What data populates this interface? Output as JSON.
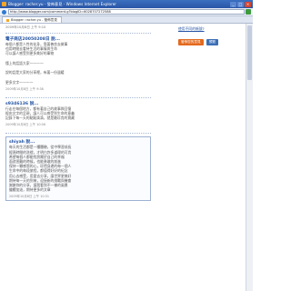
{
  "window": {
    "title": "Blogger: racher.yu - 發佈意見 - Windows Internet Explorer",
    "url": "http://www.blogger.com/comment.g?blogID=6028707272588"
  },
  "tab": {
    "label": "Blogger: racher.yu - 發佈意見"
  },
  "top_date": "2009年10月8日 上午 9:10",
  "sidebar": {
    "link": "使用不同的帳號?",
    "buttons": [
      "發佈您的意見",
      "預覽"
    ]
  },
  "comments": [
    {
      "author": "電子商店20050208日 說...",
      "lines": [
        "每個人都是人性的化身，靠著善良去做事",
        "也用時間去看待生活的事情與生命",
        "可以讓人感受到更多美好的事物",
        "",
        "懂上的話語大家一一一一",
        "",
        "說的話是大家的分享裡，有著一份溫暖",
        "",
        "更多文字一一一一"
      ],
      "date": "2009年10月8日 上午 9:38"
    },
    {
      "author": "s9346136 說...",
      "lines": [
        "行走在每個地方，都有著自己的故事與回憶",
        "經由文字的呈現，讓人可以感受到生命的意義",
        "記錄下每一天的點點滴滴，就是最珍貴的寶藏"
      ],
      "date": "2009年10月8日 上午 10:06"
    },
    {
      "author": "shiyah 說...",
      "lines": [
        "每天的生活都是一種體驗，從中學習成長",
        "經過時間的洗禮，才明白許多道理的可貴",
        "希望每個人都能找到屬於自己的幸福",
        "面對困難的時候，也能勇敢的前進",
        "保持一顆感恩的心，珍惜身邊的每一個人",
        "生命中的每段旅程，都值得好好的紀念",
        "用心去感受，用愛去分享，讓世界更美好",
        "期待每一天的到來，迎接新的挑戰與機會",
        "謝謝你的分享，讓我看到不一樣的風景",
        "繼續加油，期待更多的文章"
      ],
      "date": "2009年10月8日 上午 10:31"
    }
  ]
}
